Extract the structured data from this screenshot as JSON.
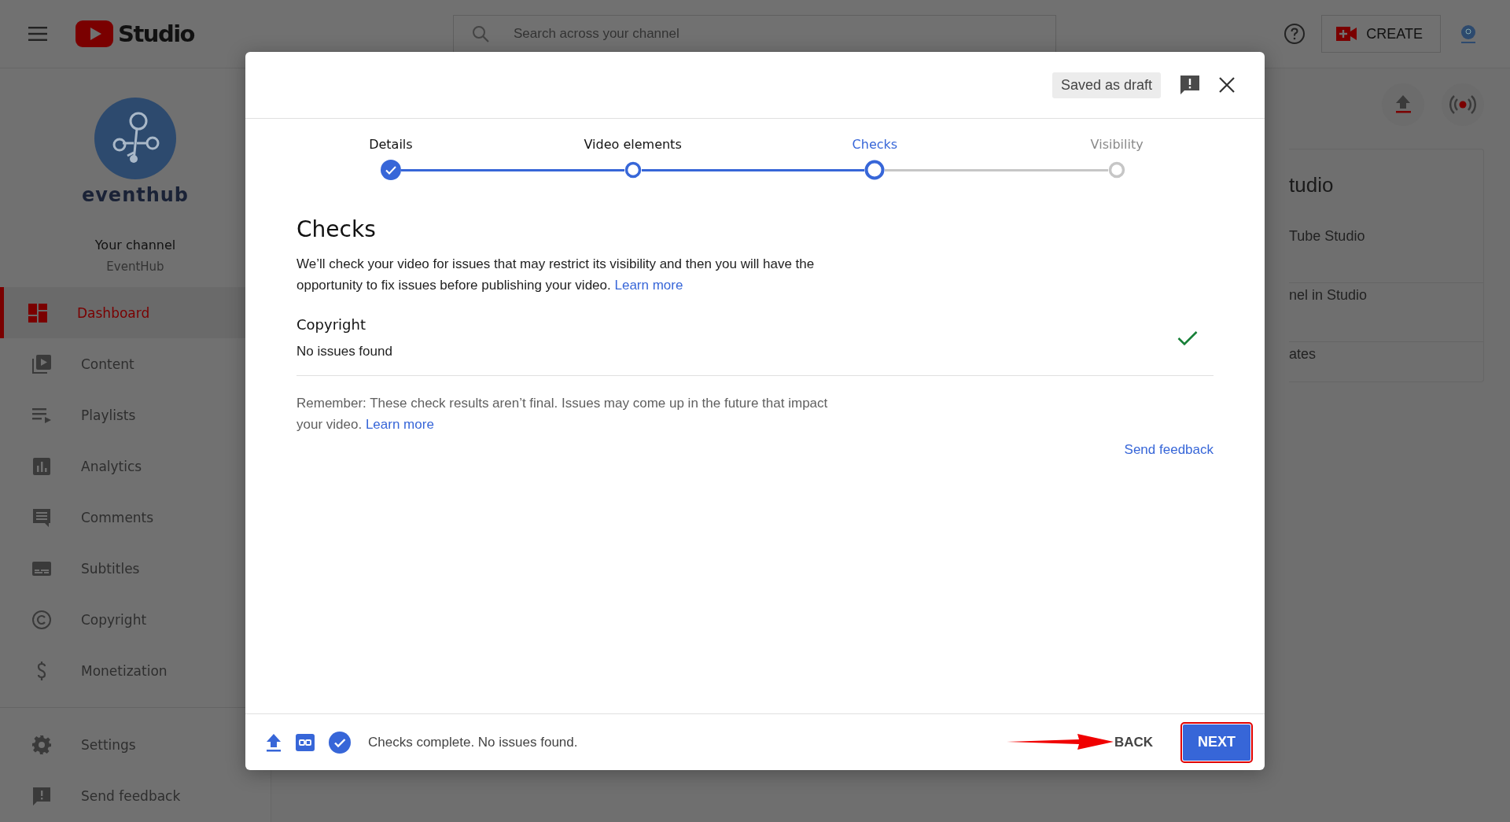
{
  "topbar": {
    "logo_text": "Studio",
    "search": {
      "placeholder": "Search across your channel"
    },
    "create_label": "CREATE"
  },
  "sidebar": {
    "brand": "eventhub",
    "channel_title": "Your channel",
    "channel_name": "EventHub",
    "items": [
      {
        "label": "Dashboard",
        "selected": true
      },
      {
        "label": "Content",
        "selected": false
      },
      {
        "label": "Playlists",
        "selected": false
      },
      {
        "label": "Analytics",
        "selected": false
      },
      {
        "label": "Comments",
        "selected": false
      },
      {
        "label": "Subtitles",
        "selected": false
      },
      {
        "label": "Copyright",
        "selected": false
      },
      {
        "label": "Monetization",
        "selected": false
      }
    ],
    "bottom_items": [
      {
        "label": "Settings",
        "selected": false
      },
      {
        "label": "Send feedback",
        "selected": false
      }
    ]
  },
  "background_card": {
    "title": "tudio",
    "items": [
      "Tube Studio",
      "nel in Studio",
      "ates"
    ]
  },
  "dialog": {
    "status": "Saved as draft",
    "steps": [
      {
        "label": "Details",
        "completed": true,
        "reached": true,
        "selected": false
      },
      {
        "label": "Video elements",
        "completed": false,
        "reached": true,
        "selected": false
      },
      {
        "label": "Checks",
        "completed": false,
        "reached": true,
        "selected": true
      },
      {
        "label": "Visibility",
        "completed": false,
        "reached": false,
        "selected": false
      }
    ],
    "heading": "Checks",
    "intro": "We’ll check your video for issues that may restrict its visibility and then you will have the opportunity to fix issues before publishing your video.",
    "intro_link": "Learn more",
    "sections": [
      {
        "title": "Copyright",
        "result": "No issues found",
        "ok": true
      }
    ],
    "note": "Remember: These check results aren’t final. Issues may come up in the future that impact your video.",
    "note_link": "Learn more",
    "feedback_link": "Send feedback",
    "footer": {
      "status": "Checks complete. No issues found.",
      "back": "BACK",
      "next": "NEXT"
    }
  }
}
